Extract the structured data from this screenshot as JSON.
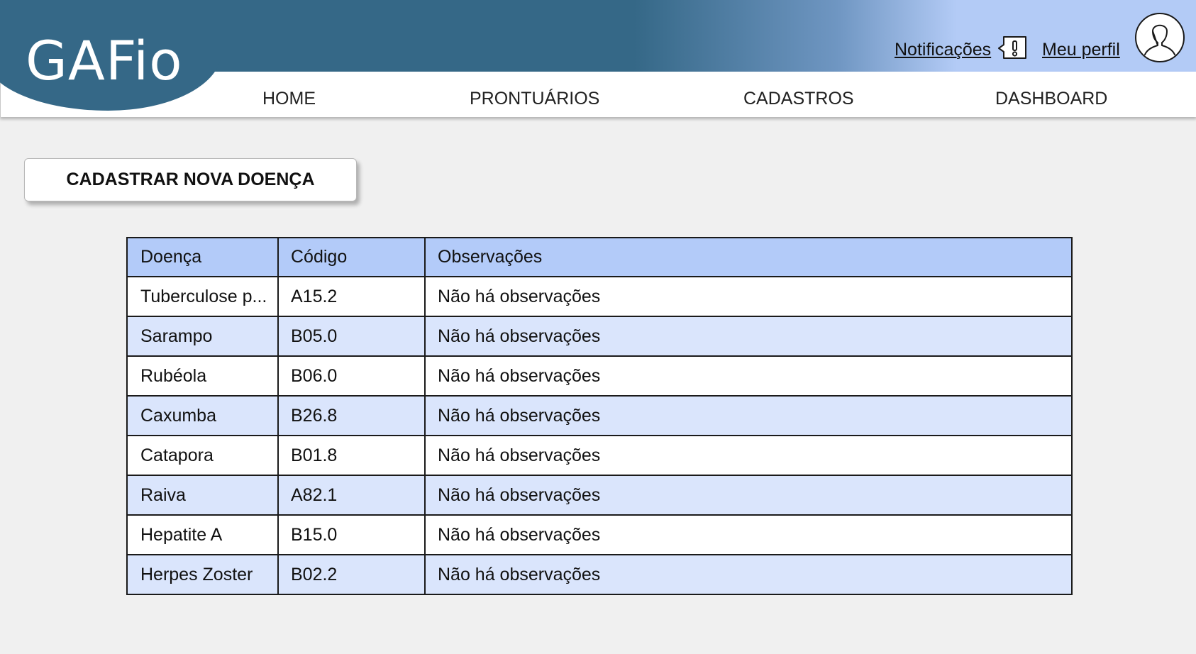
{
  "app": {
    "logo": "GAFio"
  },
  "header": {
    "notifications_label": "Notificações",
    "profile_label": "Meu perfil",
    "colors": {
      "primary": "#356887",
      "accent_light": "#b3cbf6"
    }
  },
  "nav": {
    "items": [
      {
        "label": "HOME"
      },
      {
        "label": "PRONTUÁRIOS"
      },
      {
        "label": "CADASTROS"
      },
      {
        "label": "DASHBOARD"
      }
    ]
  },
  "actions": {
    "new_disease_label": "CADASTRAR NOVA DOENÇA"
  },
  "table": {
    "columns": [
      "Doença",
      "Código",
      "Observações"
    ],
    "rows": [
      {
        "doenca": "Tuberculose p...",
        "codigo": "A15.2",
        "obs": "Não há observações"
      },
      {
        "doenca": "Sarampo",
        "codigo": "B05.0",
        "obs": "Não há observações"
      },
      {
        "doenca": "Rubéola",
        "codigo": "B06.0",
        "obs": "Não há observações"
      },
      {
        "doenca": "Caxumba",
        "codigo": "B26.8",
        "obs": "Não há observações"
      },
      {
        "doenca": "Catapora",
        "codigo": "B01.8",
        "obs": "Não há observações"
      },
      {
        "doenca": "Raiva",
        "codigo": "A82.1",
        "obs": "Não há observações"
      },
      {
        "doenca": "Hepatite A",
        "codigo": "B15.0",
        "obs": "Não há observações"
      },
      {
        "doenca": "Herpes Zoster",
        "codigo": "B02.2",
        "obs": "Não há observações"
      }
    ]
  },
  "icons": {
    "notification": "notification-bell-icon",
    "profile": "user-avatar-icon"
  }
}
